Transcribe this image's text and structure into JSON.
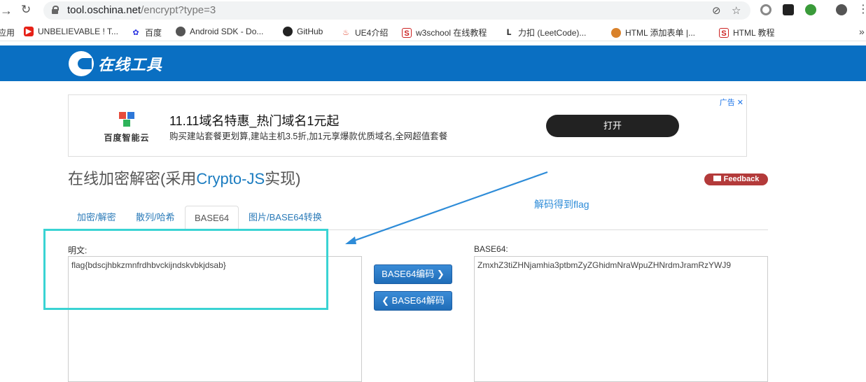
{
  "browser": {
    "url_host": "tool.oschina.net",
    "url_path": "/encrypt?type=3",
    "bookmarks": [
      {
        "label": "应用",
        "icon": "apps-icon"
      },
      {
        "label": "UNBELIEVABLE ! T...",
        "icon": "youtube-icon"
      },
      {
        "label": "百度",
        "icon": "baidu-icon"
      },
      {
        "label": "Android SDK - Do...",
        "icon": "globe-icon"
      },
      {
        "label": "GitHub",
        "icon": "github-icon"
      },
      {
        "label": "UE4介绍",
        "icon": "flame-icon"
      },
      {
        "label": "w3school 在线教程",
        "icon": "w3school-icon"
      },
      {
        "label": "力扣 (LeetCode)...",
        "icon": "leetcode-icon"
      },
      {
        "label": "HTML 添加表单 |...",
        "icon": "runoob-icon"
      },
      {
        "label": "HTML 教程",
        "icon": "w3school-icon"
      }
    ],
    "more": "»"
  },
  "site": {
    "logo_text": "在线工具"
  },
  "ad": {
    "tag": "广告 ✕",
    "brand": "百度智能云",
    "title": "11.11域名特惠_热门域名1元起",
    "subtitle": "购买建站套餐更划算,建站主机3.5折,加1元享爆款优质域名,全网超值套餐",
    "button": "打开"
  },
  "page": {
    "title_prefix": "在线加密解密(采用",
    "title_highlight": "Crypto-JS",
    "title_suffix": "实现)",
    "feedback": "Feedback",
    "annotation": "解码得到flag"
  },
  "tabs": [
    {
      "label": "加密/解密",
      "active": false
    },
    {
      "label": "散列/哈希",
      "active": false
    },
    {
      "label": "BASE64",
      "active": true
    },
    {
      "label": "图片/BASE64转换",
      "active": false
    }
  ],
  "plain": {
    "label": "明文:",
    "value": "flag{bdscjhbkzmnfrdhbvckijndskvbkjdsab}"
  },
  "encoded": {
    "label": "BASE64:",
    "value": "ZmxhZ3tiZHNjamhia3ptbmZyZGhidmNraWpuZHNrdmJramRzYWJ9"
  },
  "buttons": {
    "encode": "BASE64编码",
    "decode": "BASE64解码"
  },
  "colors": {
    "header": "#0a6fc2",
    "link": "#2a7ab8",
    "annotation": "#2e8cd8",
    "highlight": "#3ad3d3",
    "feedback": "#b33a3a"
  }
}
